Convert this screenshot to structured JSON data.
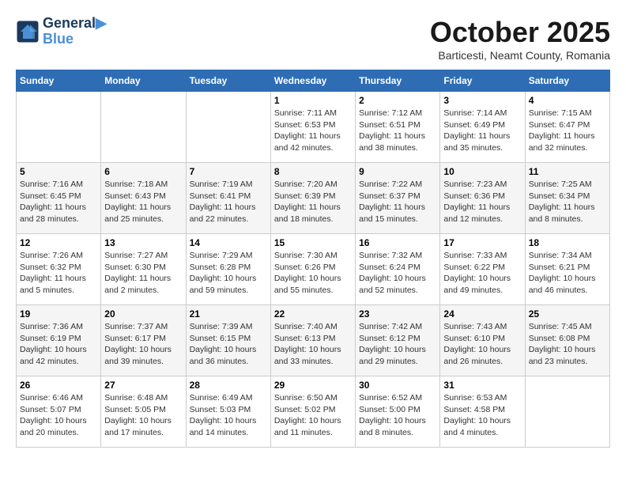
{
  "header": {
    "logo_line1": "General",
    "logo_line2": "Blue",
    "month": "October 2025",
    "location": "Barticesti, Neamt County, Romania"
  },
  "days_of_week": [
    "Sunday",
    "Monday",
    "Tuesday",
    "Wednesday",
    "Thursday",
    "Friday",
    "Saturday"
  ],
  "weeks": [
    [
      {
        "num": "",
        "sunrise": "",
        "sunset": "",
        "daylight": ""
      },
      {
        "num": "",
        "sunrise": "",
        "sunset": "",
        "daylight": ""
      },
      {
        "num": "",
        "sunrise": "",
        "sunset": "",
        "daylight": ""
      },
      {
        "num": "1",
        "sunrise": "Sunrise: 7:11 AM",
        "sunset": "Sunset: 6:53 PM",
        "daylight": "Daylight: 11 hours and 42 minutes."
      },
      {
        "num": "2",
        "sunrise": "Sunrise: 7:12 AM",
        "sunset": "Sunset: 6:51 PM",
        "daylight": "Daylight: 11 hours and 38 minutes."
      },
      {
        "num": "3",
        "sunrise": "Sunrise: 7:14 AM",
        "sunset": "Sunset: 6:49 PM",
        "daylight": "Daylight: 11 hours and 35 minutes."
      },
      {
        "num": "4",
        "sunrise": "Sunrise: 7:15 AM",
        "sunset": "Sunset: 6:47 PM",
        "daylight": "Daylight: 11 hours and 32 minutes."
      }
    ],
    [
      {
        "num": "5",
        "sunrise": "Sunrise: 7:16 AM",
        "sunset": "Sunset: 6:45 PM",
        "daylight": "Daylight: 11 hours and 28 minutes."
      },
      {
        "num": "6",
        "sunrise": "Sunrise: 7:18 AM",
        "sunset": "Sunset: 6:43 PM",
        "daylight": "Daylight: 11 hours and 25 minutes."
      },
      {
        "num": "7",
        "sunrise": "Sunrise: 7:19 AM",
        "sunset": "Sunset: 6:41 PM",
        "daylight": "Daylight: 11 hours and 22 minutes."
      },
      {
        "num": "8",
        "sunrise": "Sunrise: 7:20 AM",
        "sunset": "Sunset: 6:39 PM",
        "daylight": "Daylight: 11 hours and 18 minutes."
      },
      {
        "num": "9",
        "sunrise": "Sunrise: 7:22 AM",
        "sunset": "Sunset: 6:37 PM",
        "daylight": "Daylight: 11 hours and 15 minutes."
      },
      {
        "num": "10",
        "sunrise": "Sunrise: 7:23 AM",
        "sunset": "Sunset: 6:36 PM",
        "daylight": "Daylight: 11 hours and 12 minutes."
      },
      {
        "num": "11",
        "sunrise": "Sunrise: 7:25 AM",
        "sunset": "Sunset: 6:34 PM",
        "daylight": "Daylight: 11 hours and 8 minutes."
      }
    ],
    [
      {
        "num": "12",
        "sunrise": "Sunrise: 7:26 AM",
        "sunset": "Sunset: 6:32 PM",
        "daylight": "Daylight: 11 hours and 5 minutes."
      },
      {
        "num": "13",
        "sunrise": "Sunrise: 7:27 AM",
        "sunset": "Sunset: 6:30 PM",
        "daylight": "Daylight: 11 hours and 2 minutes."
      },
      {
        "num": "14",
        "sunrise": "Sunrise: 7:29 AM",
        "sunset": "Sunset: 6:28 PM",
        "daylight": "Daylight: 10 hours and 59 minutes."
      },
      {
        "num": "15",
        "sunrise": "Sunrise: 7:30 AM",
        "sunset": "Sunset: 6:26 PM",
        "daylight": "Daylight: 10 hours and 55 minutes."
      },
      {
        "num": "16",
        "sunrise": "Sunrise: 7:32 AM",
        "sunset": "Sunset: 6:24 PM",
        "daylight": "Daylight: 10 hours and 52 minutes."
      },
      {
        "num": "17",
        "sunrise": "Sunrise: 7:33 AM",
        "sunset": "Sunset: 6:22 PM",
        "daylight": "Daylight: 10 hours and 49 minutes."
      },
      {
        "num": "18",
        "sunrise": "Sunrise: 7:34 AM",
        "sunset": "Sunset: 6:21 PM",
        "daylight": "Daylight: 10 hours and 46 minutes."
      }
    ],
    [
      {
        "num": "19",
        "sunrise": "Sunrise: 7:36 AM",
        "sunset": "Sunset: 6:19 PM",
        "daylight": "Daylight: 10 hours and 42 minutes."
      },
      {
        "num": "20",
        "sunrise": "Sunrise: 7:37 AM",
        "sunset": "Sunset: 6:17 PM",
        "daylight": "Daylight: 10 hours and 39 minutes."
      },
      {
        "num": "21",
        "sunrise": "Sunrise: 7:39 AM",
        "sunset": "Sunset: 6:15 PM",
        "daylight": "Daylight: 10 hours and 36 minutes."
      },
      {
        "num": "22",
        "sunrise": "Sunrise: 7:40 AM",
        "sunset": "Sunset: 6:13 PM",
        "daylight": "Daylight: 10 hours and 33 minutes."
      },
      {
        "num": "23",
        "sunrise": "Sunrise: 7:42 AM",
        "sunset": "Sunset: 6:12 PM",
        "daylight": "Daylight: 10 hours and 29 minutes."
      },
      {
        "num": "24",
        "sunrise": "Sunrise: 7:43 AM",
        "sunset": "Sunset: 6:10 PM",
        "daylight": "Daylight: 10 hours and 26 minutes."
      },
      {
        "num": "25",
        "sunrise": "Sunrise: 7:45 AM",
        "sunset": "Sunset: 6:08 PM",
        "daylight": "Daylight: 10 hours and 23 minutes."
      }
    ],
    [
      {
        "num": "26",
        "sunrise": "Sunrise: 6:46 AM",
        "sunset": "Sunset: 5:07 PM",
        "daylight": "Daylight: 10 hours and 20 minutes."
      },
      {
        "num": "27",
        "sunrise": "Sunrise: 6:48 AM",
        "sunset": "Sunset: 5:05 PM",
        "daylight": "Daylight: 10 hours and 17 minutes."
      },
      {
        "num": "28",
        "sunrise": "Sunrise: 6:49 AM",
        "sunset": "Sunset: 5:03 PM",
        "daylight": "Daylight: 10 hours and 14 minutes."
      },
      {
        "num": "29",
        "sunrise": "Sunrise: 6:50 AM",
        "sunset": "Sunset: 5:02 PM",
        "daylight": "Daylight: 10 hours and 11 minutes."
      },
      {
        "num": "30",
        "sunrise": "Sunrise: 6:52 AM",
        "sunset": "Sunset: 5:00 PM",
        "daylight": "Daylight: 10 hours and 8 minutes."
      },
      {
        "num": "31",
        "sunrise": "Sunrise: 6:53 AM",
        "sunset": "Sunset: 4:58 PM",
        "daylight": "Daylight: 10 hours and 4 minutes."
      },
      {
        "num": "",
        "sunrise": "",
        "sunset": "",
        "daylight": ""
      }
    ]
  ]
}
